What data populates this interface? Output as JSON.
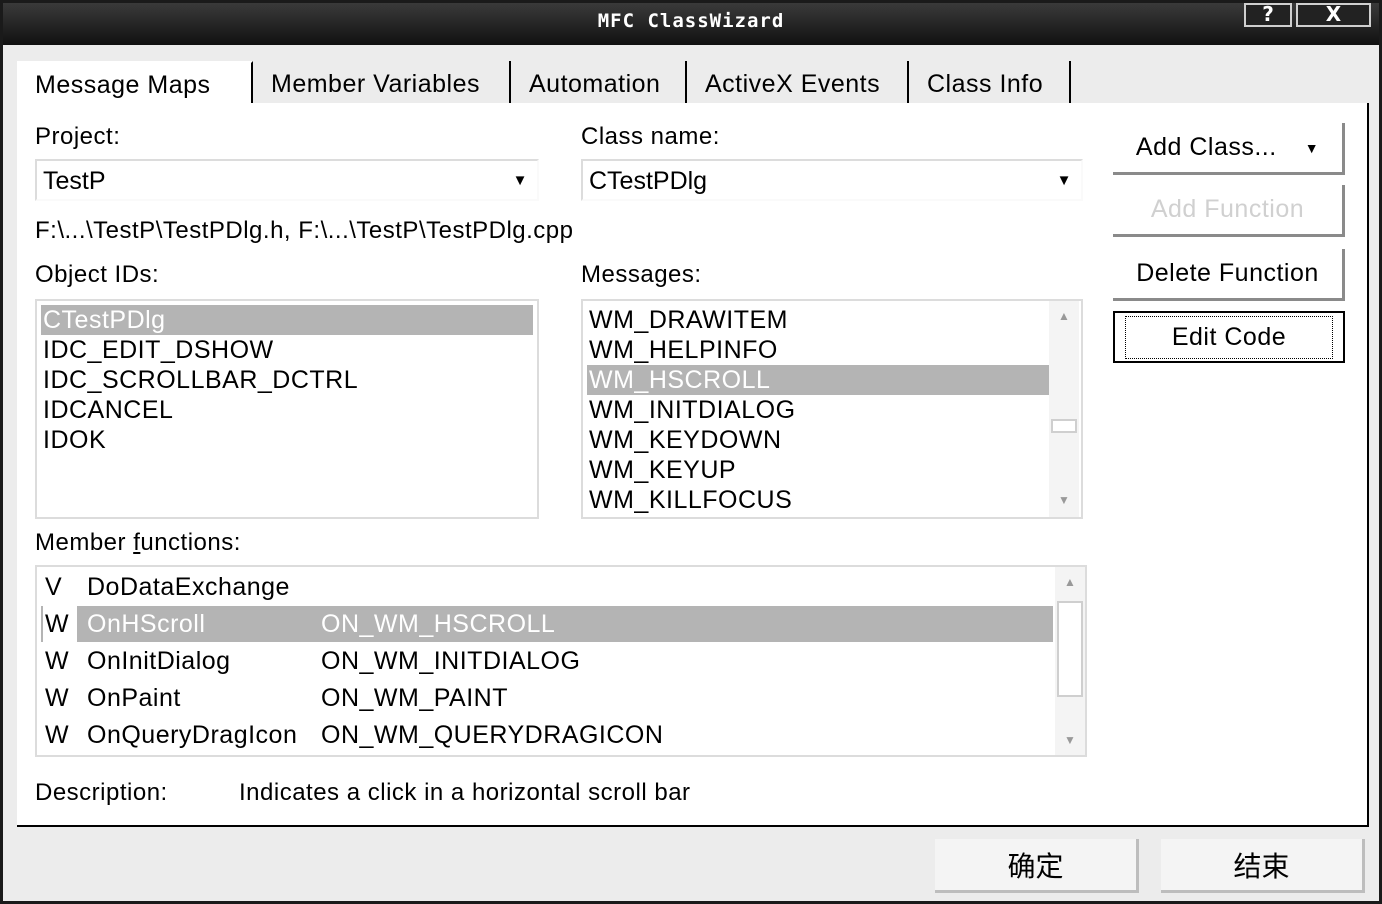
{
  "window": {
    "title": "MFC ClassWizard",
    "help_label": "?",
    "close_label": "X"
  },
  "tabs": [
    {
      "label": "Message Maps",
      "active": true
    },
    {
      "label": "Member Variables",
      "active": false
    },
    {
      "label": "Automation",
      "active": false
    },
    {
      "label": "ActiveX Events",
      "active": false
    },
    {
      "label": "Class Info",
      "active": false
    }
  ],
  "project": {
    "label": "Project:",
    "value": "TestP"
  },
  "class_name": {
    "label": "Class name:",
    "value": "CTestPDlg"
  },
  "file_path": "F:\\...\\TestP\\TestPDlg.h, F:\\...\\TestP\\TestPDlg.cpp",
  "object_ids": {
    "label": "Object IDs:",
    "items": [
      "CTestPDlg",
      "IDC_EDIT_DSHOW",
      "IDC_SCROLLBAR_DCTRL",
      "IDCANCEL",
      "IDOK"
    ],
    "selected_index": 0
  },
  "messages": {
    "label": "Messages:",
    "items": [
      "WM_DRAWITEM",
      "WM_HELPINFO",
      "WM_HSCROLL",
      "WM_INITDIALOG",
      "WM_KEYDOWN",
      "WM_KEYUP",
      "WM_KILLFOCUS"
    ],
    "selected_index": 2
  },
  "member_functions": {
    "label": "Member functions:",
    "rows": [
      {
        "type": "V",
        "name": "DoDataExchange",
        "handler": ""
      },
      {
        "type": "W",
        "name": "OnHScroll",
        "handler": "ON_WM_HSCROLL"
      },
      {
        "type": "W",
        "name": "OnInitDialog",
        "handler": "ON_WM_INITDIALOG"
      },
      {
        "type": "W",
        "name": "OnPaint",
        "handler": "ON_WM_PAINT"
      },
      {
        "type": "W",
        "name": "OnQueryDragIcon",
        "handler": "ON_WM_QUERYDRAGICON"
      }
    ],
    "selected_index": 1
  },
  "description": {
    "label": "Description:",
    "text": "Indicates a click in a horizontal scroll bar"
  },
  "buttons": {
    "add_class": "Add Class...",
    "add_function": "Add Function",
    "delete_function": "Delete Function",
    "edit_code": "Edit Code",
    "ok": "确定",
    "cancel": "结束"
  }
}
